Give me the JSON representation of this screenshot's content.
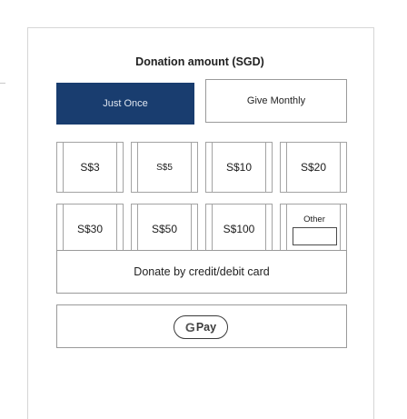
{
  "title": "Donation amount (SGD)",
  "frequency": {
    "once_label": "Just Once",
    "monthly_label": "Give Monthly",
    "selected": "Just Once"
  },
  "amounts": {
    "row1": [
      "S$3",
      "S$5",
      "S$10",
      "S$20"
    ],
    "row2": [
      "S$30",
      "S$50",
      "S$100"
    ]
  },
  "other": {
    "label": "Other",
    "value": ""
  },
  "payment": {
    "card_label": "Donate by credit/debit card",
    "gpay_g": "G",
    "gpay_label": "Pay"
  },
  "colors": {
    "primary": "#193d6f",
    "border": "#9a9a9a"
  }
}
